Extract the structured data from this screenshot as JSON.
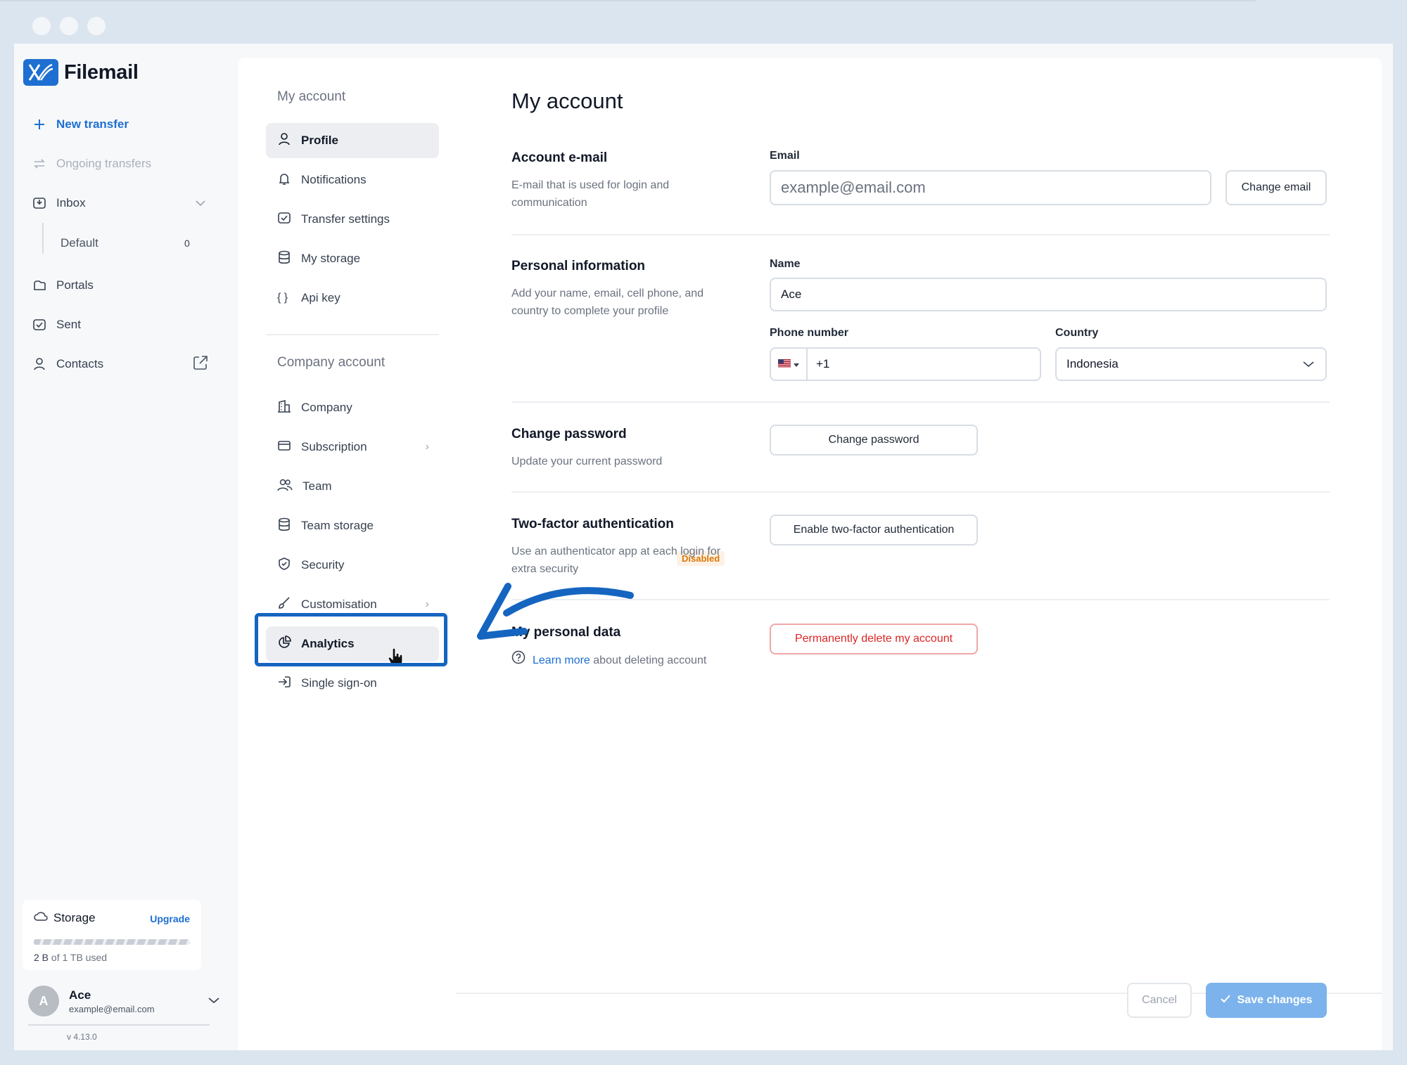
{
  "app": {
    "name": "Filemail",
    "version": "v 4.13.0"
  },
  "sidebar": {
    "new_transfer": "New transfer",
    "ongoing_transfers": "Ongoing transfers",
    "inbox": "Inbox",
    "inbox_default": "Default",
    "inbox_default_count": "0",
    "portals": "Portals",
    "sent": "Sent",
    "contacts": "Contacts",
    "storage": {
      "label": "Storage",
      "upgrade": "Upgrade",
      "used_amount": "2 B",
      "used_suffix": " of 1 TB used"
    },
    "user": {
      "initial": "A",
      "name": "Ace",
      "email": "example@email.com"
    }
  },
  "menu": {
    "my_account_heading": "My account",
    "my_account_items": [
      "Profile",
      "Notifications",
      "Transfer settings",
      "My storage",
      "Api key"
    ],
    "company_heading": "Company account",
    "company_items": [
      "Company",
      "Subscription",
      "Team",
      "Team storage",
      "Security",
      "Customisation",
      "Analytics",
      "Single sign-on"
    ]
  },
  "content": {
    "title": "My account",
    "email_section": {
      "title": "Account e-mail",
      "desc": "E-mail that is used for login and communication",
      "field_label": "Email",
      "placeholder": "example@email.com",
      "button": "Change email"
    },
    "personal_section": {
      "title": "Personal information",
      "desc": "Add your name, email, cell phone, and country to complete your profile",
      "name_label": "Name",
      "name_value": "Ace",
      "phone_label": "Phone number",
      "phone_code": "+1",
      "country_label": "Country",
      "country_value": "Indonesia"
    },
    "password_section": {
      "title": "Change password",
      "desc": "Update your current password",
      "button": "Change password"
    },
    "twofa_section": {
      "title": "Two-factor authentication",
      "badge": "Disabled",
      "desc": "Use an authenticator app at each login for extra security",
      "button": "Enable two-factor authentication"
    },
    "personal_data_section": {
      "title": "My personal data",
      "link": "Learn more",
      "desc_suffix": "about deleting account",
      "button": "Permanently delete my account"
    },
    "footer": {
      "cancel": "Cancel",
      "save": "Save changes"
    }
  },
  "colors": {
    "brand": "#1d6fd1",
    "annotation": "#1565c0",
    "danger": "#dc2626",
    "warning": "#d97706"
  }
}
